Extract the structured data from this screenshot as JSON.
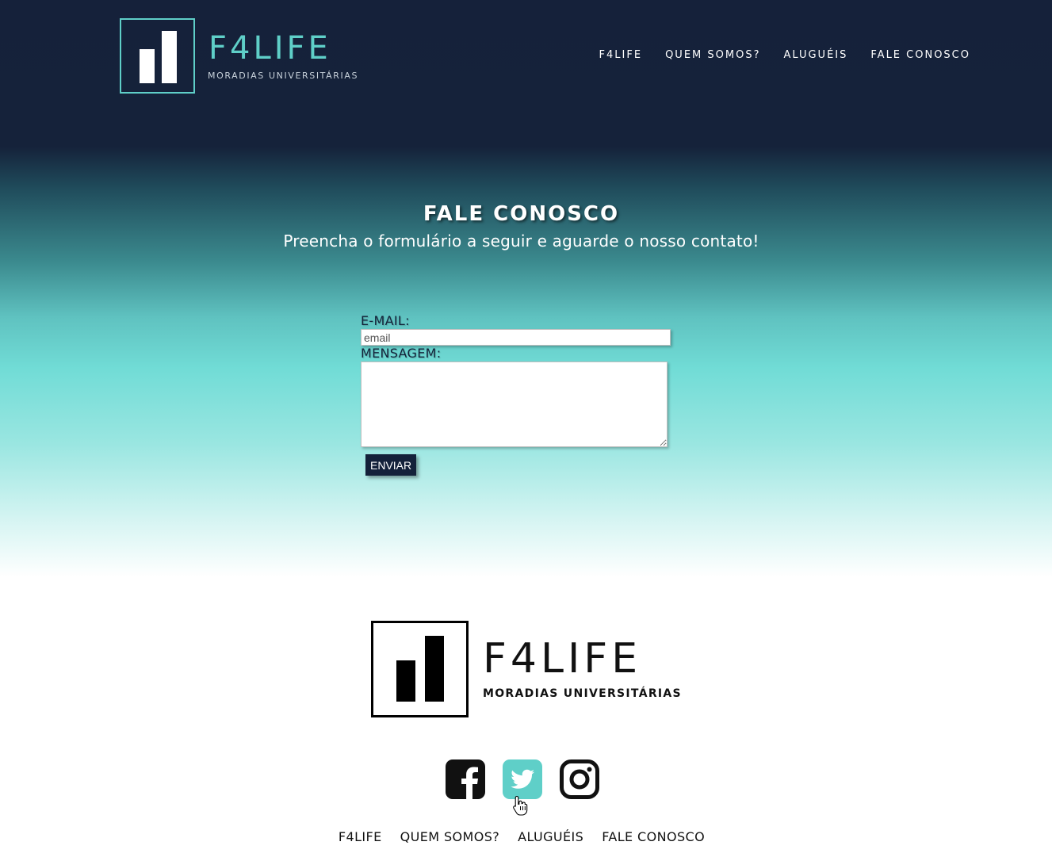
{
  "header": {
    "brand_name": "F4LIFE",
    "brand_sub": "MORADIAS UNIVERSITÁRIAS",
    "nav": [
      "F4LIFE",
      "QUEM SOMOS?",
      "ALUGUÉIS",
      "FALE CONOSCO"
    ]
  },
  "contact": {
    "title": "FALE CONOSCO",
    "subtitle": "Preencha o formulário a seguir e aguarde o nosso contato!",
    "email_label": "E-MAIL:",
    "email_placeholder": "email",
    "email_value": "",
    "message_label": "MENSAGEM:",
    "message_value": "",
    "submit_label": "ENVIAR"
  },
  "footer": {
    "brand_name": "F4LIFE",
    "brand_sub": "MORADIAS UNIVERSITÁRIAS",
    "social": [
      {
        "icon": "facebook-icon",
        "color": "#111111"
      },
      {
        "icon": "twitter-icon",
        "color": "#5fcfc8"
      },
      {
        "icon": "instagram-icon",
        "color": "#111111"
      }
    ],
    "nav": [
      "F4LIFE",
      "QUEM SOMOS?",
      "ALUGUÉIS",
      "FALE CONOSCO"
    ]
  },
  "colors": {
    "header_bg": "#15213a",
    "accent": "#5fcfc8",
    "button_bg": "#14213a"
  }
}
